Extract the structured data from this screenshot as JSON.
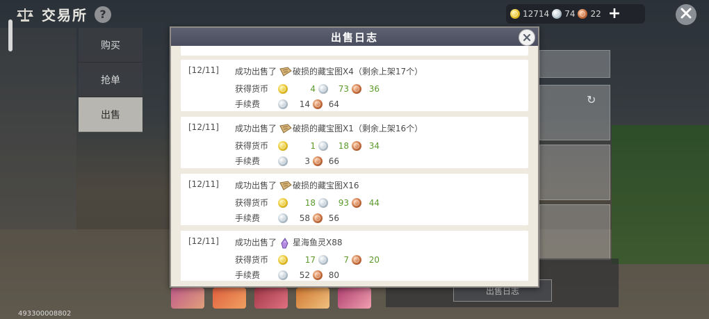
{
  "app": {
    "title": "交易所",
    "help_label": "?",
    "uid": "493300008802"
  },
  "currency": {
    "gold": "12714",
    "silver": "74",
    "bronze": "22",
    "add_label": "+"
  },
  "nav": {
    "items": [
      {
        "label": "购买"
      },
      {
        "label": "抢单"
      },
      {
        "label": "出售"
      }
    ]
  },
  "bottom": {
    "log_button": "出售日志"
  },
  "modal": {
    "title": "出售日志",
    "earn_label": "获得货币",
    "fee_label": "手续费",
    "entries": [
      {
        "date": "[12/11]",
        "prefix": "成功出售了",
        "item_icon": "treasure-map-icon",
        "item": "破损的藏宝图X4（剩余上架17个）",
        "earn_gold": "4",
        "earn_silver": "73",
        "earn_bronze": "36",
        "fee_silver": "14",
        "fee_bronze": "64"
      },
      {
        "date": "[12/11]",
        "prefix": "成功出售了",
        "item_icon": "treasure-map-icon",
        "item": "破损的藏宝图X1（剩余上架16个）",
        "earn_gold": "1",
        "earn_silver": "18",
        "earn_bronze": "34",
        "fee_silver": "3",
        "fee_bronze": "66"
      },
      {
        "date": "[12/11]",
        "prefix": "成功出售了",
        "item_icon": "treasure-map-icon",
        "item": "破损的藏宝图X16",
        "earn_gold": "18",
        "earn_silver": "93",
        "earn_bronze": "44",
        "fee_silver": "58",
        "fee_bronze": "56"
      },
      {
        "date": "[12/11]",
        "prefix": "成功出售了",
        "item_icon": "sea-fish-spirit-icon",
        "item": "星海鱼灵X88",
        "earn_gold": "17",
        "earn_silver": "7",
        "earn_bronze": "20",
        "fee_silver": "52",
        "fee_bronze": "80"
      }
    ]
  },
  "colors": {
    "header": "#4a4d5e",
    "earn_green": "#5a9a2a",
    "nav_active": "#b8b6b0"
  }
}
